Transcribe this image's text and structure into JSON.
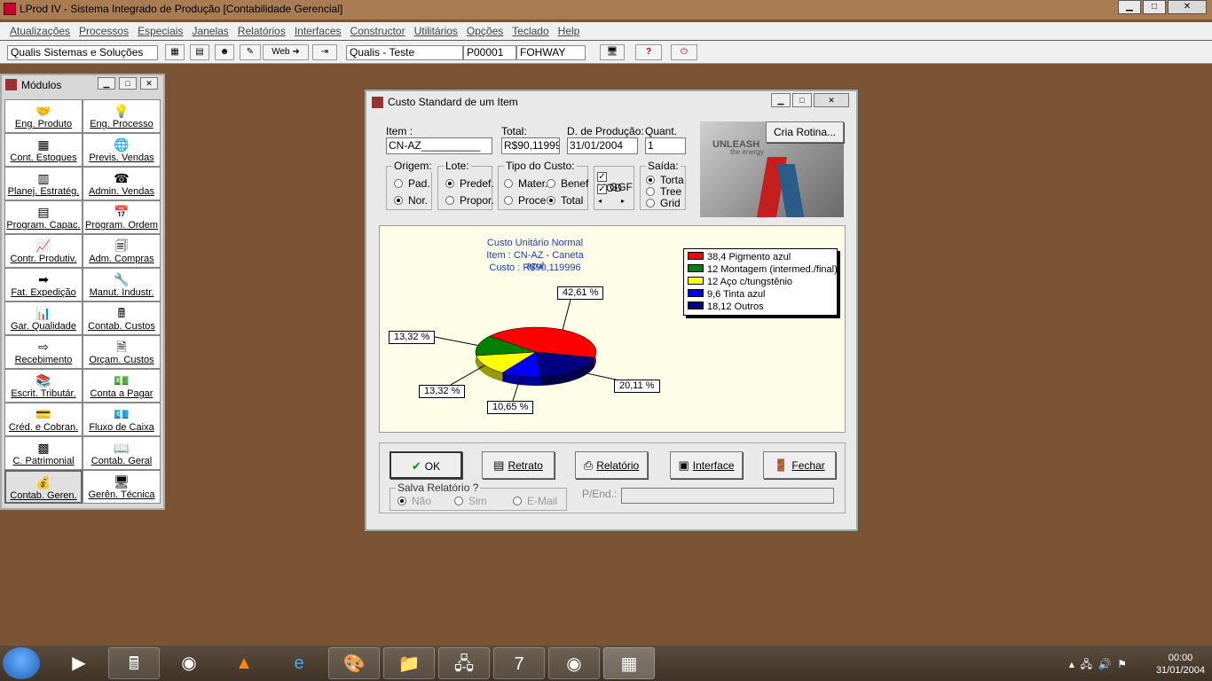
{
  "window": {
    "title": "LProd IV - Sistema Integrado de Produção [Contabilidade Gerencial]"
  },
  "menu": [
    "Atualizações",
    "Processos",
    "Especiais",
    "Janelas",
    "Relatórios",
    "Interfaces",
    "Constructor",
    "Utilitários",
    "Opções",
    "Teclado",
    "Help"
  ],
  "toolbar": {
    "company": "Qualis Sistemas e Soluções",
    "web_label": "Web",
    "database": "Qualis - Teste",
    "code": "P00001",
    "name": "FOHWAY"
  },
  "modules": {
    "title": "Módulos",
    "items": [
      "Eng. Produto",
      "Eng. Processo",
      "Cont. Estoques",
      "Previs. Vendas",
      "Planej. Estratég.",
      "Admin. Vendas",
      "Program. Capac.",
      "Program. Ordem",
      "Contr. Produtiv.",
      "Adm. Compras",
      "Fat. Expedição",
      "Manut. Industr.",
      "Gar. Qualidade",
      "Contab. Custos",
      "Recebimento",
      "Orçam. Custos",
      "Escrit. Tributár.",
      "Conta a Pagar",
      "Créd. e Cobran.",
      "Fluxo de Caixa",
      "C. Patrimonial",
      "Contab. Geral",
      "Contab. Geren.",
      "Gerên. Técnica"
    ]
  },
  "dialog": {
    "title": "Custo Standard de um Item",
    "item_label": "Item :",
    "item_value": "CN-AZ__________",
    "total_label": "Total:",
    "total_value": "R$90,119996",
    "date_label": "D. de Produção:",
    "date_value": "31/01/2004",
    "qty_label": "Quant.",
    "qty_value": "1",
    "cria_rotina": "Cria Rotina...",
    "banner_text": "UNLEASH",
    "banner_sub": "the energy",
    "origem": {
      "title": "Origem:",
      "opt1": "Pad.",
      "opt2": "Nor."
    },
    "lote": {
      "title": "Lote:",
      "opt1": "Predef.",
      "opt2": "Propor."
    },
    "tipo": {
      "title": "Tipo do Custo:",
      "opt1": "Mater.",
      "opt2": "Benef",
      "opt3": "Proce",
      "opt4": "Total"
    },
    "checks": {
      "mod": "MOD",
      "ggf": "GGF"
    },
    "saida": {
      "title": "Saída:",
      "opt1": "Torta",
      "opt2": "Tree",
      "opt3": "Grid"
    },
    "buttons": {
      "ok": "OK",
      "retrato": "Retrato",
      "relatorio": "Relatório",
      "interface": "Interface",
      "fechar": "Fechar"
    },
    "salva": {
      "title": "Salva Relatório ?",
      "opt1": "Não",
      "opt2": "Sim",
      "opt3": "E-Mail"
    },
    "pend_label": "P/End.:"
  },
  "chart_data": {
    "type": "pie",
    "title": "Custo Unitário Normal",
    "subtitle1": "Item : CN-AZ - Caneta azul",
    "subtitle2": "Custo : R$90,119996",
    "legend": [
      "38,4 Pigmento azul",
      "12 Montagem (intermed./final)",
      "12 Aço c/tungstênio",
      "9,6 Tinta azul",
      "18,12 Outros"
    ],
    "values": [
      38.4,
      12,
      12,
      9.6,
      18.12
    ],
    "percent_labels": [
      "42,61 %",
      "13,32 %",
      "13,32 %",
      "10,65 %",
      "20,11 %"
    ],
    "colors": [
      "#ff0000",
      "#008000",
      "#ffff00",
      "#0000ff",
      "#000080"
    ]
  },
  "taskbar": {
    "time": "00:00",
    "date": "31/01/2004"
  }
}
